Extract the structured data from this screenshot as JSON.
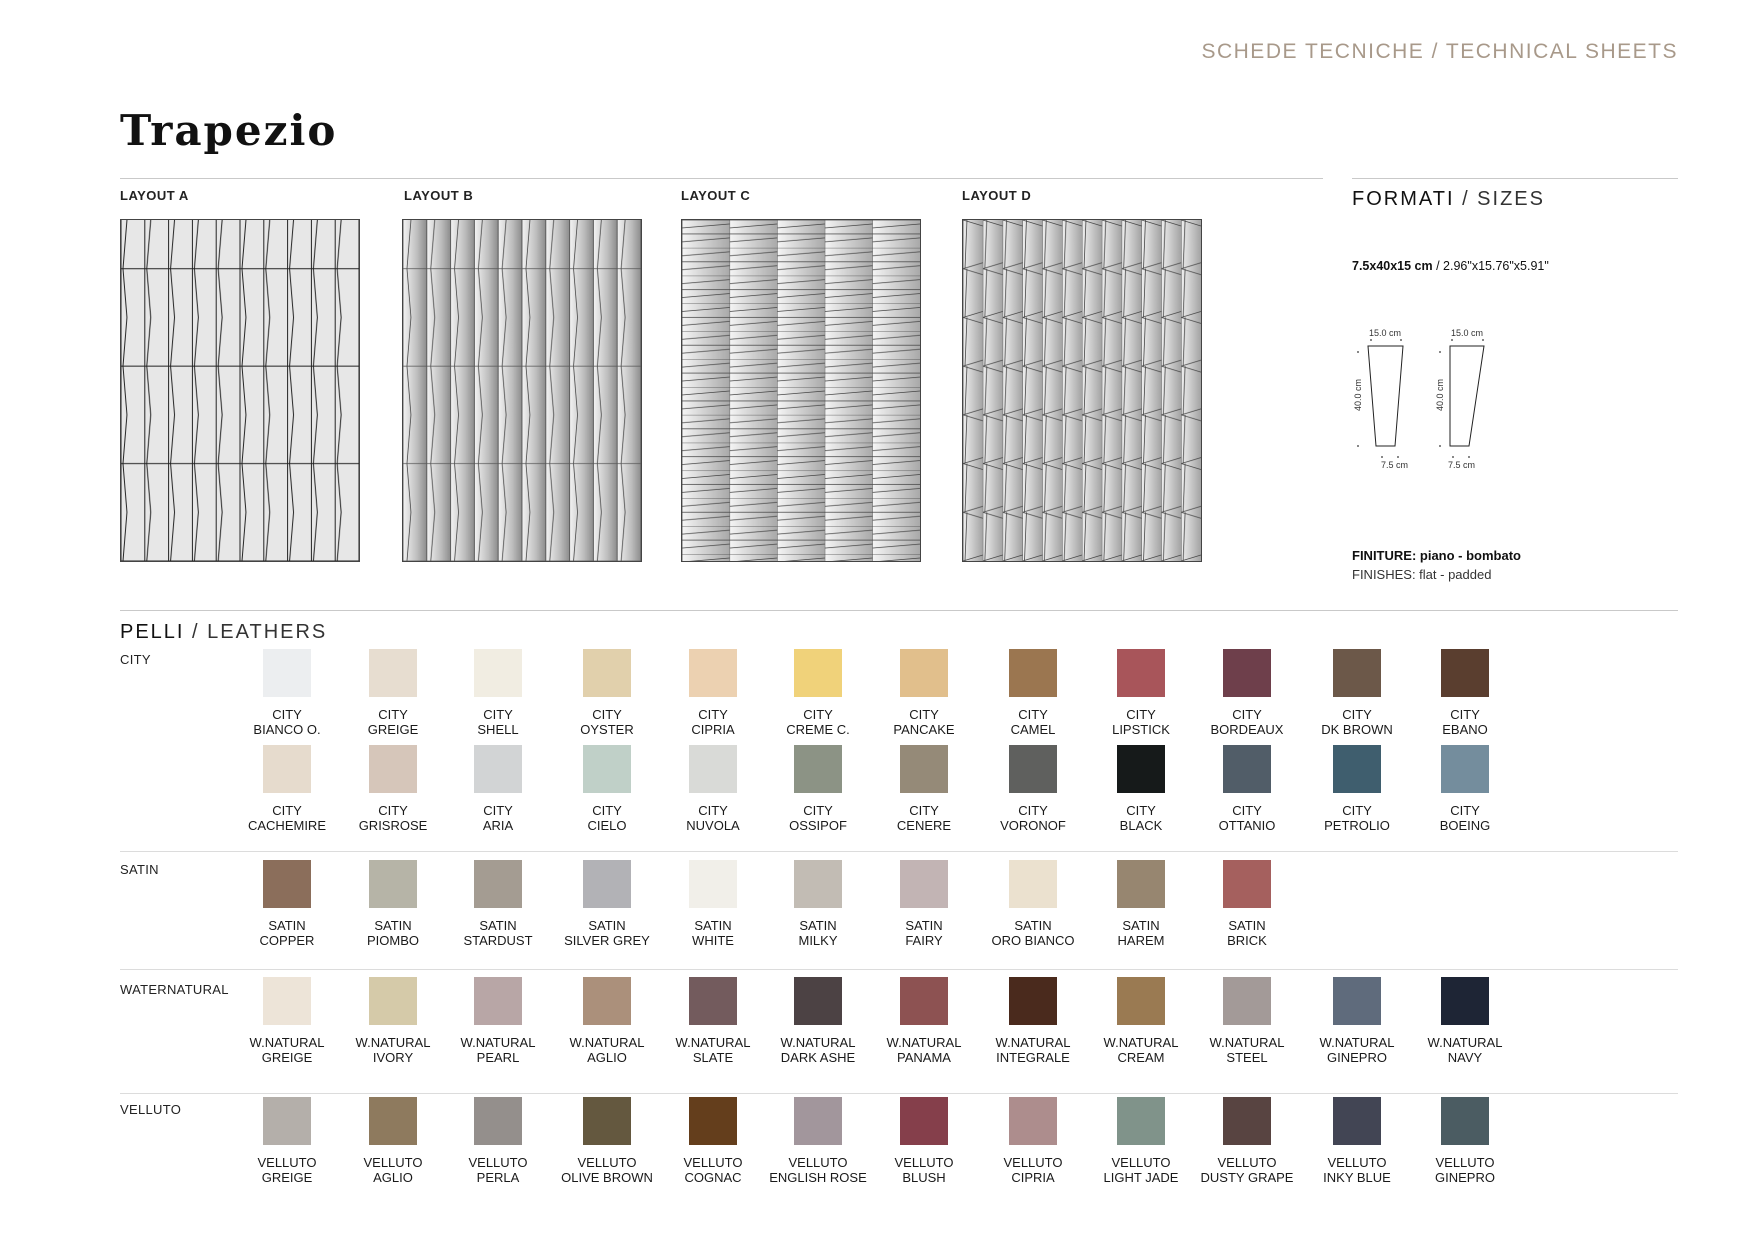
{
  "header": {
    "section": "SCHEDE TECNICHE / TECHNICAL SHEETS"
  },
  "title": "Trapezio",
  "layouts": [
    "LAYOUT A",
    "LAYOUT B",
    "LAYOUT C",
    "LAYOUT D"
  ],
  "sizes": {
    "title_main": "FORMATI",
    "title_sub": " / SIZES",
    "format_main": "7.5x40x15 cm",
    "format_sub": " / 2.96\"x15.76\"x5.91\"",
    "top_dim": "15.0 cm",
    "side_dim": "40.0 cm",
    "bottom_dim": "7.5 cm"
  },
  "finishes": {
    "label_it": "FINITURE:",
    "value_it": " piano - bombato",
    "label_en": "FINISHES: flat - padded"
  },
  "leathers": {
    "title_main": "PELLI",
    "title_sub": " / LEATHERS",
    "groups": [
      {
        "label": "CITY",
        "rows": [
          [
            {
              "l1": "CITY",
              "l2": "BIANCO O.",
              "color": "#eceef0"
            },
            {
              "l1": "CITY",
              "l2": "GREIGE",
              "color": "#e7ddd0"
            },
            {
              "l1": "CITY",
              "l2": "SHELL",
              "color": "#f1ede2"
            },
            {
              "l1": "CITY",
              "l2": "OYSTER",
              "color": "#e1d0ac"
            },
            {
              "l1": "CITY",
              "l2": "CIPRIA",
              "color": "#ecd1b1"
            },
            {
              "l1": "CITY",
              "l2": "CREME C.",
              "color": "#f0d27a"
            },
            {
              "l1": "CITY",
              "l2": "PANCAKE",
              "color": "#e1bf8c"
            },
            {
              "l1": "CITY",
              "l2": "CAMEL",
              "color": "#9b7650"
            },
            {
              "l1": "CITY",
              "l2": "LIPSTICK",
              "color": "#a8555a"
            },
            {
              "l1": "CITY",
              "l2": "BORDEAUX",
              "color": "#6e3f4b"
            },
            {
              "l1": "CITY",
              "l2": "DK BROWN",
              "color": "#6c5849"
            },
            {
              "l1": "CITY",
              "l2": "EBANO",
              "color": "#5a3e2f"
            }
          ],
          [
            {
              "l1": "CITY",
              "l2": "CACHEMIRE",
              "color": "#e6dbcd"
            },
            {
              "l1": "CITY",
              "l2": "GRISROSE",
              "color": "#d6c6ba"
            },
            {
              "l1": "CITY",
              "l2": "ARIA",
              "color": "#d2d4d5"
            },
            {
              "l1": "CITY",
              "l2": "CIELO",
              "color": "#c0d0c8"
            },
            {
              "l1": "CITY",
              "l2": "NUVOLA",
              "color": "#d9dad7"
            },
            {
              "l1": "CITY",
              "l2": "OSSIPOF",
              "color": "#8c9385"
            },
            {
              "l1": "CITY",
              "l2": "CENERE",
              "color": "#958a78"
            },
            {
              "l1": "CITY",
              "l2": "VORONOF",
              "color": "#5f605e"
            },
            {
              "l1": "CITY",
              "l2": "BLACK",
              "color": "#161a1a"
            },
            {
              "l1": "CITY",
              "l2": "OTTANIO",
              "color": "#515d68"
            },
            {
              "l1": "CITY",
              "l2": "PETROLIO",
              "color": "#3f5e6e"
            },
            {
              "l1": "CITY",
              "l2": "BOEING",
              "color": "#748d9d"
            }
          ]
        ]
      },
      {
        "label": "SATIN",
        "rows": [
          [
            {
              "l1": "SATIN",
              "l2": "COPPER",
              "color": "#8b6e5b"
            },
            {
              "l1": "SATIN",
              "l2": "PIOMBO",
              "color": "#b6b4a7"
            },
            {
              "l1": "SATIN",
              "l2": "STARDUST",
              "color": "#a49c92"
            },
            {
              "l1": "SATIN",
              "l2": "SILVER GREY",
              "color": "#b2b2b6"
            },
            {
              "l1": "SATIN",
              "l2": "WHITE",
              "color": "#f1efe9"
            },
            {
              "l1": "SATIN",
              "l2": "MILKY",
              "color": "#c2bcb4"
            },
            {
              "l1": "SATIN",
              "l2": "FAIRY",
              "color": "#c2b4b4"
            },
            {
              "l1": "SATIN",
              "l2": "ORO BIANCO",
              "color": "#ebe1cf"
            },
            {
              "l1": "SATIN",
              "l2": "HAREM",
              "color": "#978670"
            },
            {
              "l1": "SATIN",
              "l2": "BRICK",
              "color": "#a5605e"
            }
          ]
        ]
      },
      {
        "label": "WATERNATURAL",
        "rows": [
          [
            {
              "l1": "W.NATURAL",
              "l2": "GREIGE",
              "color": "#ede4d8"
            },
            {
              "l1": "W.NATURAL",
              "l2": "IVORY",
              "color": "#d5caa9"
            },
            {
              "l1": "W.NATURAL",
              "l2": "PEARL",
              "color": "#b8a6a6"
            },
            {
              "l1": "W.NATURAL",
              "l2": "AGLIO",
              "color": "#ab907b"
            },
            {
              "l1": "W.NATURAL",
              "l2": "SLATE",
              "color": "#735b5d"
            },
            {
              "l1": "W.NATURAL",
              "l2": "DARK ASHE",
              "color": "#4c4244"
            },
            {
              "l1": "W.NATURAL",
              "l2": "PANAMA",
              "color": "#8d5252"
            },
            {
              "l1": "W.NATURAL",
              "l2": "INTEGRALE",
              "color": "#4a2a1d"
            },
            {
              "l1": "W.NATURAL",
              "l2": "CREAM",
              "color": "#9a7a52"
            },
            {
              "l1": "W.NATURAL",
              "l2": "STEEL",
              "color": "#a39a98"
            },
            {
              "l1": "W.NATURAL",
              "l2": "GINEPRO",
              "color": "#5f6b7c"
            },
            {
              "l1": "W.NATURAL",
              "l2": "NAVY",
              "color": "#1e2535"
            }
          ]
        ]
      },
      {
        "label": "VELLUTO",
        "rows": [
          [
            {
              "l1": "VELLUTO",
              "l2": "GREIGE",
              "color": "#b4afaa"
            },
            {
              "l1": "VELLUTO",
              "l2": "AGLIO",
              "color": "#8e7a5e"
            },
            {
              "l1": "VELLUTO",
              "l2": "PERLA",
              "color": "#948f8c"
            },
            {
              "l1": "VELLUTO",
              "l2": "OLIVE BROWN",
              "color": "#64583f"
            },
            {
              "l1": "VELLUTO",
              "l2": "COGNAC",
              "color": "#643e1c"
            },
            {
              "l1": "VELLUTO",
              "l2": "ENGLISH ROSE",
              "color": "#a2969c"
            },
            {
              "l1": "VELLUTO",
              "l2": "BLUSH",
              "color": "#853f4b"
            },
            {
              "l1": "VELLUTO",
              "l2": "CIPRIA",
              "color": "#ad8d8d"
            },
            {
              "l1": "VELLUTO",
              "l2": "LIGHT JADE",
              "color": "#80938a"
            },
            {
              "l1": "VELLUTO",
              "l2": "DUSTY GRAPE",
              "color": "#584441"
            },
            {
              "l1": "VELLUTO",
              "l2": "INKY BLUE",
              "color": "#424554"
            },
            {
              "l1": "VELLUTO",
              "l2": "GINEPRO",
              "color": "#4b5c62"
            }
          ]
        ]
      }
    ]
  }
}
